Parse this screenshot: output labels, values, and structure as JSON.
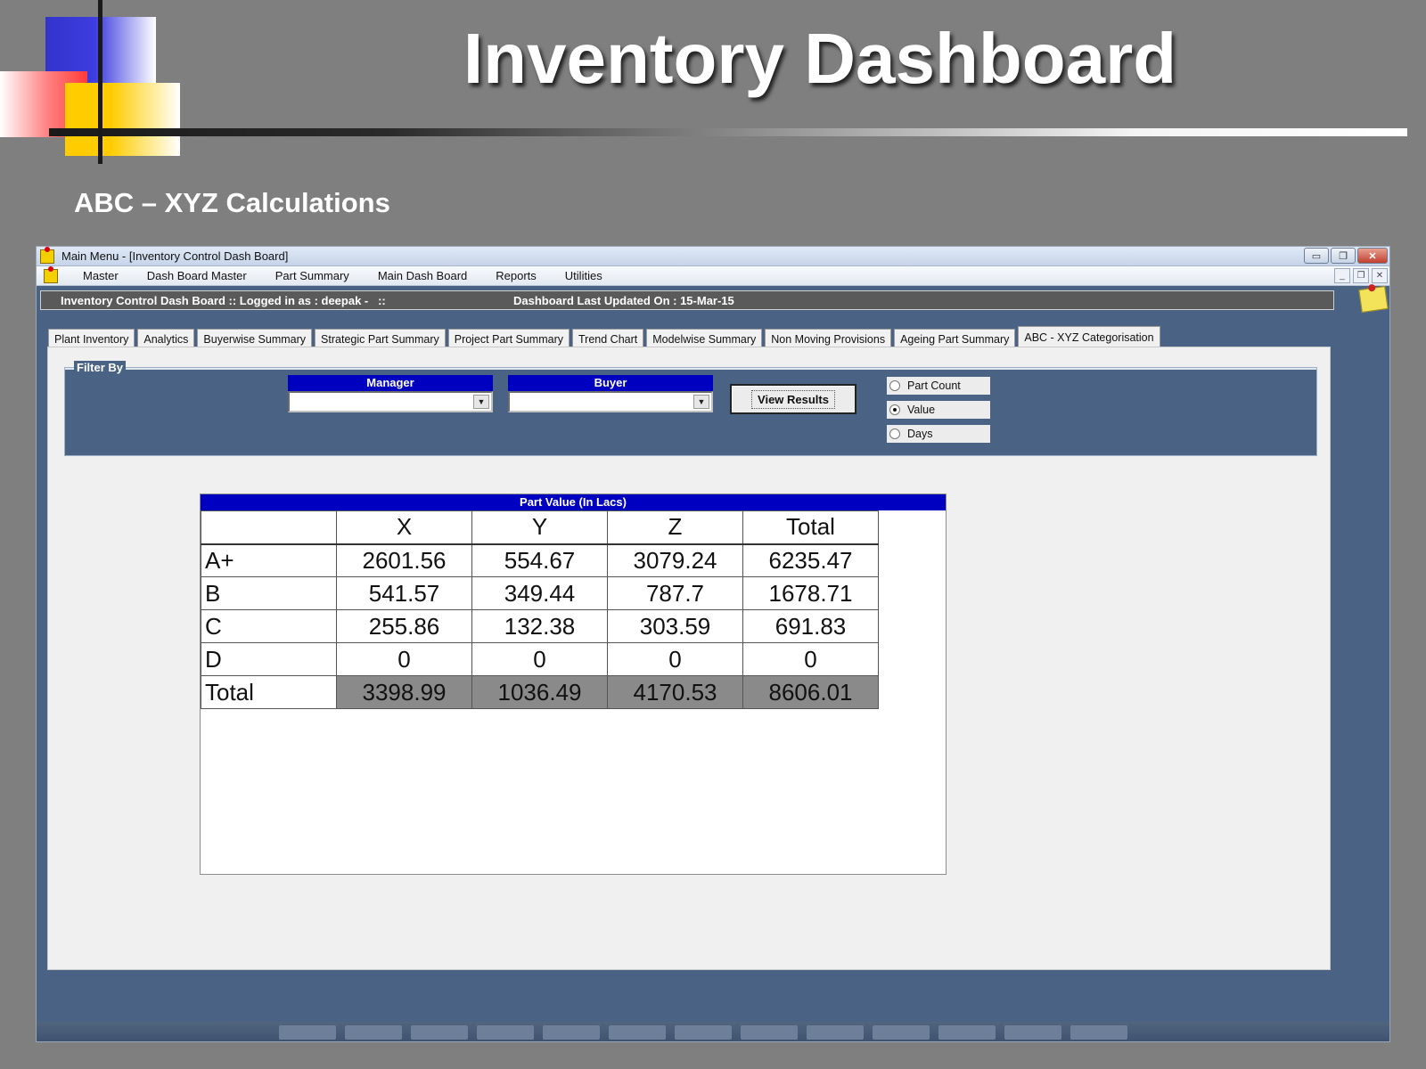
{
  "slide": {
    "title": "Inventory Dashboard",
    "subtitle": "ABC – XYZ Calculations"
  },
  "window": {
    "title": "Main Menu - [Inventory Control Dash Board]",
    "controls": {
      "minimize": "▭",
      "restore": "❐",
      "close": "✕"
    },
    "mdi_controls": {
      "minimize": "_",
      "restore": "❐",
      "close": "✕"
    }
  },
  "menu": {
    "items": [
      "Master",
      "Dash Board Master",
      "Part Summary",
      "Main Dash Board",
      "Reports",
      "Utilities"
    ]
  },
  "status": {
    "left": "Inventory Control Dash Board :: Logged in as : deepak -   ::",
    "right": "Dashboard Last Updated On : 15-Mar-15"
  },
  "tabs": [
    {
      "label": "Plant Inventory",
      "active": false
    },
    {
      "label": "Analytics",
      "active": false
    },
    {
      "label": "Buyerwise Summary",
      "active": false
    },
    {
      "label": "Strategic Part Summary",
      "active": false
    },
    {
      "label": "Project Part Summary",
      "active": false
    },
    {
      "label": "Trend Chart",
      "active": false
    },
    {
      "label": "Modelwise Summary",
      "active": false
    },
    {
      "label": "Non Moving Provisions",
      "active": false
    },
    {
      "label": "Ageing Part Summary",
      "active": false
    },
    {
      "label": "ABC - XYZ Categorisation",
      "active": true
    }
  ],
  "filter": {
    "legend": "Filter By",
    "manager_label": "Manager",
    "manager_value": "",
    "buyer_label": "Buyer",
    "buyer_value": "",
    "view_button": "View Results",
    "options": [
      {
        "label": "Part Count",
        "checked": false
      },
      {
        "label": "Value",
        "checked": true
      },
      {
        "label": "Days",
        "checked": false
      }
    ]
  },
  "grid": {
    "title": "Part Value (In Lacs)",
    "columns": [
      "",
      "X",
      "Y",
      "Z",
      "Total"
    ],
    "rows": [
      {
        "label": "A+",
        "values": [
          "2601.56",
          "554.67",
          "3079.24",
          "6235.47"
        ]
      },
      {
        "label": "B",
        "values": [
          "541.57",
          "349.44",
          "787.7",
          "1678.71"
        ]
      },
      {
        "label": "C",
        "values": [
          "255.86",
          "132.38",
          "303.59",
          "691.83"
        ]
      },
      {
        "label": "D",
        "values": [
          "0",
          "0",
          "0",
          "0"
        ]
      },
      {
        "label": "Total",
        "values": [
          "3398.99",
          "1036.49",
          "4170.53",
          "8606.01"
        ]
      }
    ]
  }
}
